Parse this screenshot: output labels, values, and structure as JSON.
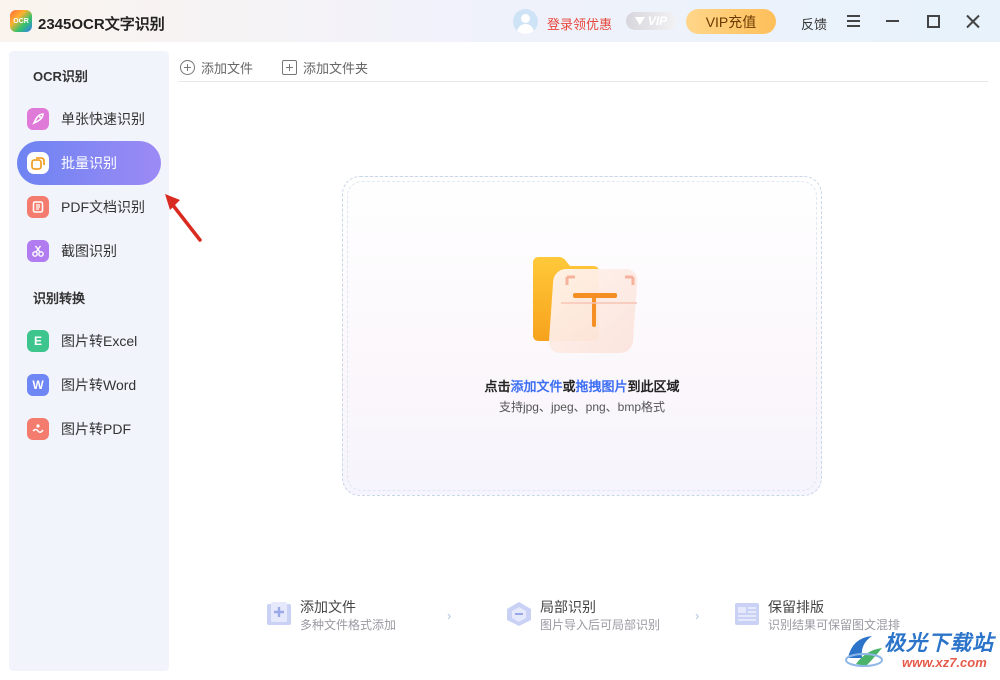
{
  "app": {
    "logo_text": "OCR",
    "title": "2345OCR文字识别"
  },
  "header": {
    "login_label": "登录领优惠",
    "vip_badge": "VIP",
    "vip_button": "VIP充值",
    "feedback": "反馈"
  },
  "sidebar": {
    "section1": "OCR识别",
    "section2": "识别转换",
    "items": [
      {
        "label": "单张快速识别",
        "icon": "rocket-icon",
        "color": "#e07ad8"
      },
      {
        "label": "批量识别",
        "icon": "batch-icon",
        "color": "#f2a12b",
        "active": true
      },
      {
        "label": "PDF文档识别",
        "icon": "document-icon",
        "color": "#f47c6e"
      },
      {
        "label": "截图识别",
        "icon": "scissors-icon",
        "color": "#b07cf0"
      },
      {
        "label": "图片转Excel",
        "icon": "excel-icon",
        "color": "#3ec48d",
        "glyph": "E"
      },
      {
        "label": "图片转Word",
        "icon": "word-icon",
        "color": "#6f86f5",
        "glyph": "W"
      },
      {
        "label": "图片转PDF",
        "icon": "pdf-image-icon",
        "color": "#f47c6e"
      }
    ]
  },
  "toolbar": {
    "add_file": "添加文件",
    "add_folder": "添加文件夹"
  },
  "dropzone": {
    "title_prefix": "点击",
    "title_link1": "添加文件",
    "title_mid": "或",
    "title_link2": "拖拽图片",
    "title_suffix": "到此区域",
    "subtitle": "支持jpg、jpeg、png、bmp格式",
    "link_color": "#3d6ff5"
  },
  "steps": [
    {
      "title": "添加文件",
      "desc": "多种文件格式添加",
      "icon": "add-file-step-icon"
    },
    {
      "title": "局部识别",
      "desc": "图片导入后可局部识别",
      "icon": "partial-recognition-icon"
    },
    {
      "title": "保留排版",
      "desc": "识别结果可保留图文混排",
      "icon": "keep-layout-icon"
    }
  ],
  "step_separator": "›",
  "watermark": {
    "title": "极光下载站",
    "url": "www.xz7.com"
  }
}
